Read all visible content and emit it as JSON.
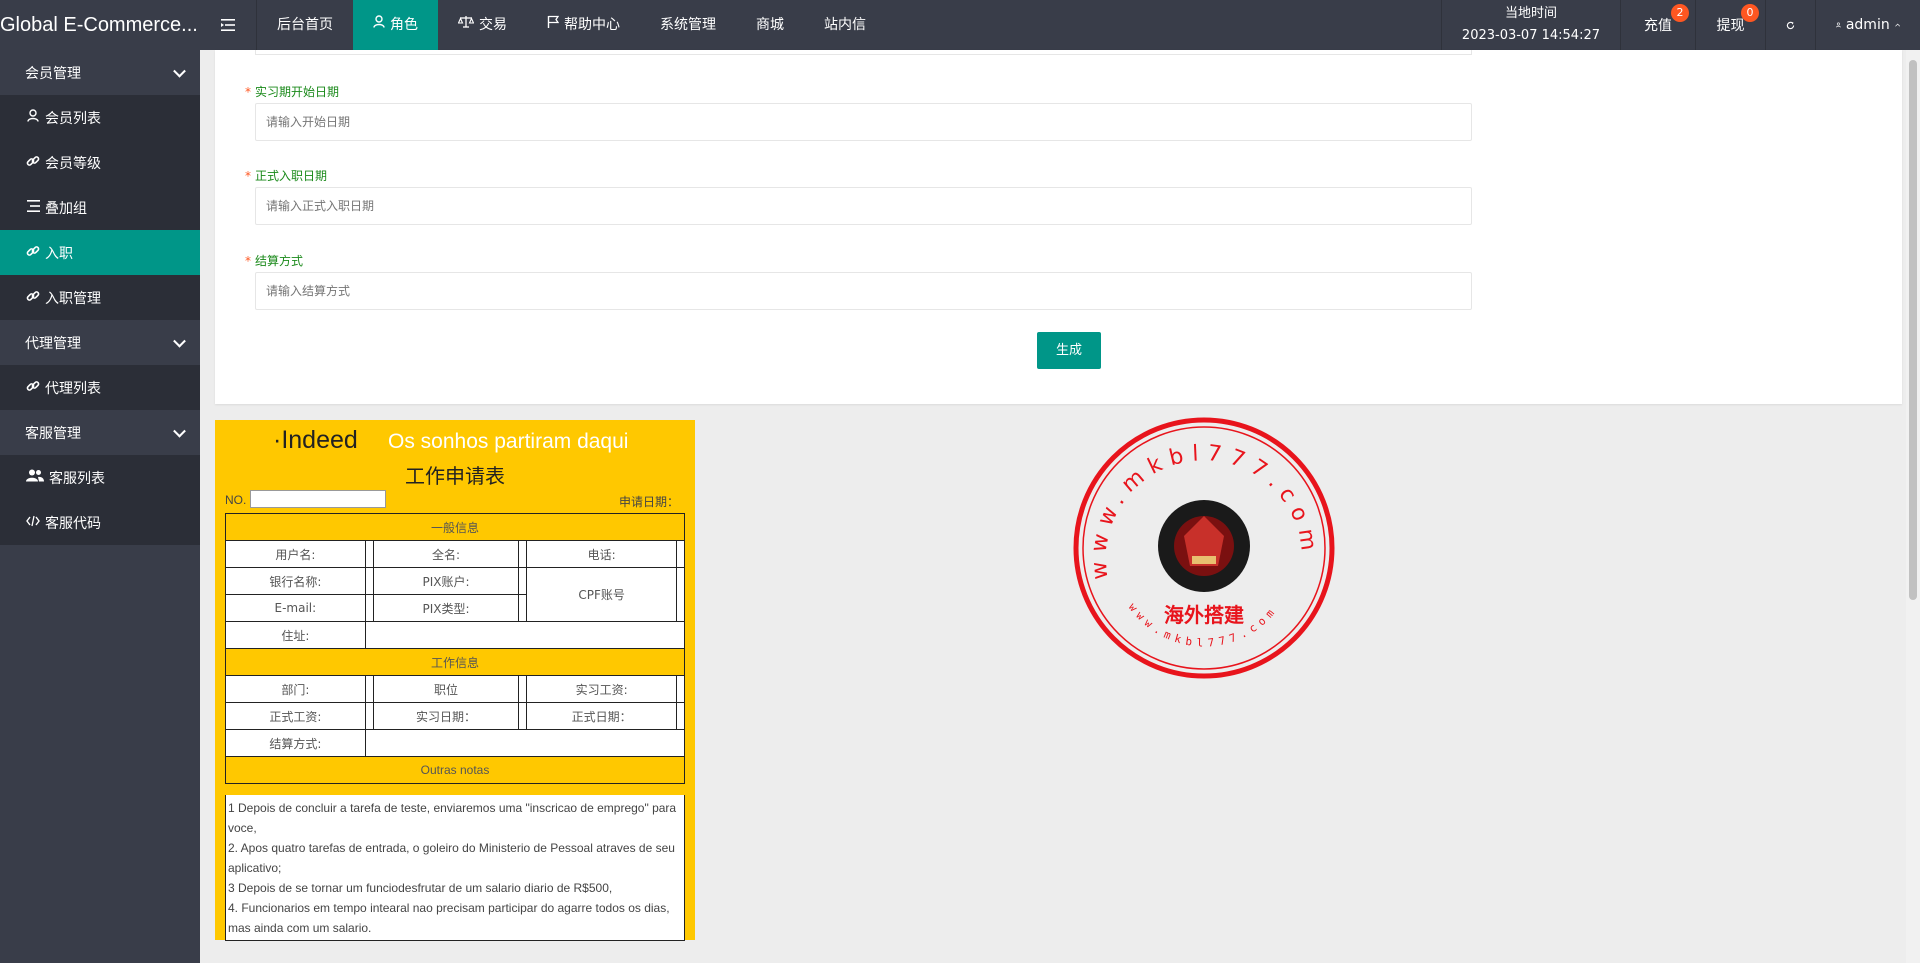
{
  "header": {
    "logo": "Global E-Commerce...",
    "nav": [
      {
        "label": "后台首页",
        "icon": ""
      },
      {
        "label": "角色",
        "icon": "user-icon",
        "active": true
      },
      {
        "label": "交易",
        "icon": "scale-icon"
      },
      {
        "label": "帮助中心",
        "icon": "flag-icon"
      },
      {
        "label": "系统管理",
        "icon": ""
      },
      {
        "label": "商城",
        "icon": ""
      },
      {
        "label": "站内信",
        "icon": ""
      }
    ],
    "local_time_label": "当地时间",
    "local_time_value": "2023-03-07 14:54:27",
    "recharge_label": "充值",
    "recharge_badge": "2",
    "withdraw_label": "提现",
    "withdraw_badge": "0",
    "user_label": "admin"
  },
  "sidebar": {
    "groups": [
      {
        "label": "会员管理",
        "items": [
          {
            "label": "会员列表",
            "icon": "user-icon"
          },
          {
            "label": "会员等级",
            "icon": "link-icon"
          },
          {
            "label": "叠加组",
            "icon": "list-icon"
          },
          {
            "label": "入职",
            "icon": "link-icon",
            "active": true
          },
          {
            "label": "入职管理",
            "icon": "link-icon"
          }
        ]
      },
      {
        "label": "代理管理",
        "items": [
          {
            "label": "代理列表",
            "icon": "link-icon"
          }
        ]
      },
      {
        "label": "客服管理",
        "items": [
          {
            "label": "客服列表",
            "icon": "users-icon"
          },
          {
            "label": "客服代码",
            "icon": "code-icon"
          }
        ]
      }
    ]
  },
  "form": {
    "fields": [
      {
        "label": "实习期开始日期",
        "placeholder": "请输入开始日期"
      },
      {
        "label": "正式入职日期",
        "placeholder": "请输入正式入职日期"
      },
      {
        "label": "结算方式",
        "placeholder": "请输入结算方式"
      }
    ],
    "required_mark": "*",
    "submit_label": "生成"
  },
  "application": {
    "brand": "·Indeed",
    "slogan": "Os sonhos partiram daqui",
    "title": "工作申请表",
    "no_label": "NO.",
    "date_label": "申请日期：",
    "section_general": "一般信息",
    "username": "用户名:",
    "fullname": "全名:",
    "phone": "电话:",
    "bank_name": "银行名称:",
    "pix_account": "PIX账户:",
    "cpf": "CPF账号",
    "email": "E-mail:",
    "pix_type": "PIX类型:",
    "address": "住址:",
    "section_job": "工作信息",
    "department": "部门:",
    "position": "职位",
    "intern_salary": "实习工资:",
    "formal_salary": "正式工资:",
    "intern_date": "实习日期：",
    "formal_date": "正式日期：",
    "settlement": "结算方式:",
    "section_notes": "Outras notas",
    "notes": [
      "1 Depois de concluir a tarefa de teste, enviaremos uma \"inscricao de emprego\" para voce,",
      "2. Apos quatro tarefas de entrada, o goleiro do Ministerio de Pessoal atraves de seu aplicativo;",
      "3 Depois de se tornar um funciodesfrutar de um salario diario de R$500,",
      "4. Funcionarios em tempo intearal nao precisam participar do agarre todos os dias, mas ainda com um salario."
    ]
  },
  "stamp": {
    "ring_text": "www.mkbl777.com",
    "inner_text": "海外搭建",
    "bottom_text": "www.mkbl777.com",
    "color": "#e8141c"
  }
}
